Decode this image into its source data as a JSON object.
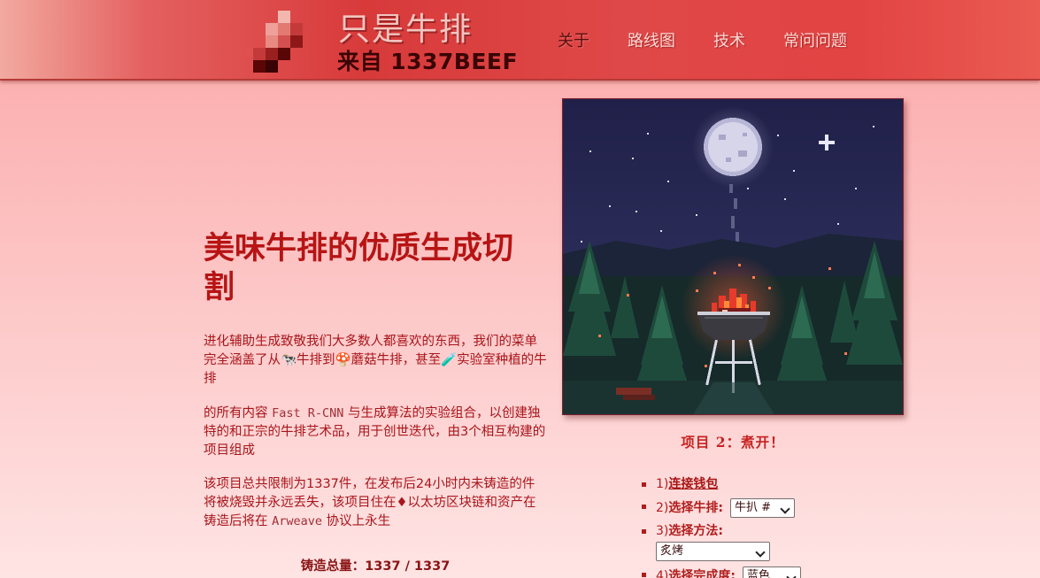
{
  "header": {
    "title_cn": "只是牛排",
    "title_en": "来自 1337BEEF",
    "nav": [
      "关于",
      "路线图",
      "技术",
      "常问问题"
    ]
  },
  "hero": {
    "title": "美味牛排的优质生成切割"
  },
  "content": {
    "p1": "进化辅助生成致敬我们大多数人都喜欢的东西，我们的菜单完全涵盖了从🐄牛排到🍄蘑菇牛排，甚至🧪实验室种植的牛排",
    "p2_prefix": "的所有内容 ",
    "p2_mono": "Fast R-CNN",
    "p2_suffix": " 与生成算法的实验组合，以创建独特的和正宗的牛排艺术品，用于创世迭代，由3个相互构建的项目组成",
    "p3_prefix": "该项目总共限制为1337件，在发布后24小时内未铸造的件将被烧毁并永远丢失，该项目住在♦以太坊区块链和资产在铸造后将在 ",
    "p3_mono": "Arweave",
    "p3_suffix": " 协议上永生",
    "mint_total": "铸造总量：1337 / 1337"
  },
  "project": {
    "caption": "项目 2：煮开！",
    "steps": [
      {
        "num": "1)",
        "label": "连接钱包"
      },
      {
        "num": "2)",
        "label": "选择牛排:",
        "value": "牛扒 #"
      },
      {
        "num": "3)",
        "label": "选择方法:",
        "value": "炙烤"
      },
      {
        "num": "4)",
        "label": "选择完成度:",
        "value": "蓝色的"
      }
    ]
  },
  "colors": {
    "accent": "#b71414",
    "header_red": "#d83a3a",
    "sky": "#27284f"
  }
}
